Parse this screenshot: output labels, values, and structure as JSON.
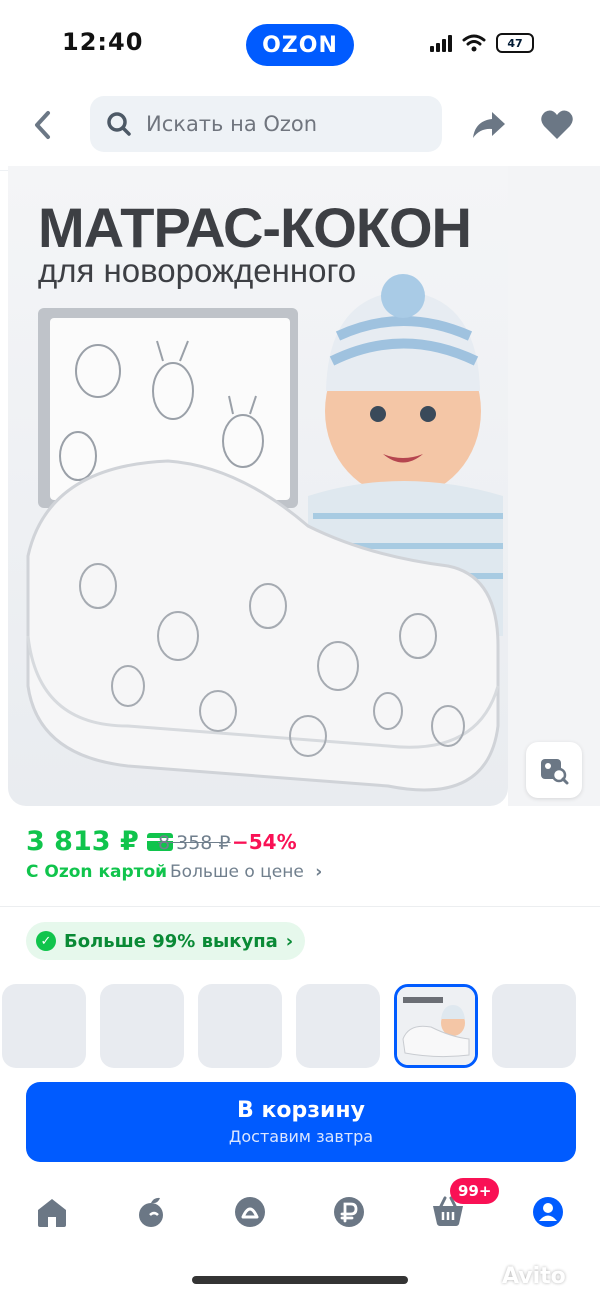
{
  "status_bar": {
    "time": "12:40",
    "battery": "47"
  },
  "brand": {
    "logo_text": "OZON",
    "accent": "#005bff"
  },
  "search": {
    "placeholder": "Искать на Ozon"
  },
  "product_image": {
    "title": "МАТРАС-КОКОН",
    "subtitle": "для новорожденного"
  },
  "price": {
    "current": "3 813 ₽",
    "old": "8 358 ₽",
    "discount": "−54%",
    "card_label": "С Ozon картой",
    "more_label": "Больше о цене",
    "green": "#10c44c",
    "discount_color": "#f91155"
  },
  "buyout": {
    "label": "Больше 99% выкупа"
  },
  "thumbnails": {
    "count": 6,
    "active_index": 4
  },
  "cart_button": {
    "label": "В корзину",
    "sublabel": "Доставим завтра"
  },
  "bottom_nav": {
    "items": [
      "home-icon",
      "fresh-icon",
      "sales-icon",
      "ruble-icon",
      "cart-icon",
      "profile-icon"
    ],
    "cart_badge": "99+"
  },
  "watermark": "Avito"
}
